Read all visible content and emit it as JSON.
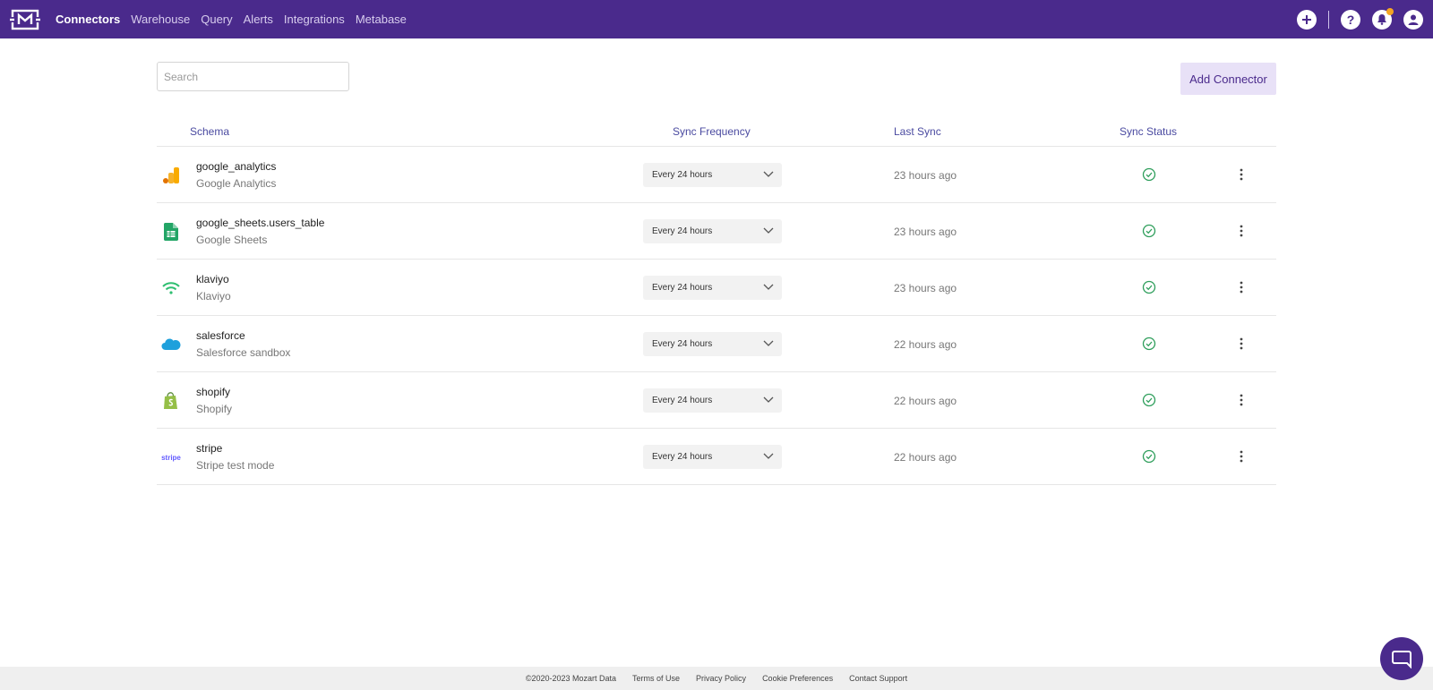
{
  "brand": {
    "logo_icon": "mozart-logo-icon",
    "color": "#4a2a8c"
  },
  "nav": {
    "items": [
      {
        "label": "Connectors",
        "active": true
      },
      {
        "label": "Warehouse",
        "active": false
      },
      {
        "label": "Query",
        "active": false
      },
      {
        "label": "Alerts",
        "active": false
      },
      {
        "label": "Integrations",
        "active": false
      },
      {
        "label": "Metabase",
        "active": false
      }
    ]
  },
  "top_actions": {
    "add_icon": "plus-icon",
    "help_label": "?",
    "notification_icon": "bell-icon",
    "account_icon": "user-icon"
  },
  "search": {
    "placeholder": "Search",
    "value": ""
  },
  "add_connector": {
    "label": "Add Connector"
  },
  "table": {
    "headers": {
      "schema": "Schema",
      "sync_frequency": "Sync Frequency",
      "last_sync": "Last Sync",
      "sync_status": "Sync Status"
    },
    "rows": [
      {
        "icon": "google-analytics-icon",
        "schema": "google_analytics",
        "name": "Google Analytics",
        "frequency": "Every 24 hours",
        "last_sync": "23 hours ago",
        "status": "success"
      },
      {
        "icon": "google-sheets-icon",
        "schema": "google_sheets.users_table",
        "name": "Google Sheets",
        "frequency": "Every 24 hours",
        "last_sync": "23 hours ago",
        "status": "success"
      },
      {
        "icon": "klaviyo-icon",
        "schema": "klaviyo",
        "name": "Klaviyo",
        "frequency": "Every 24 hours",
        "last_sync": "23 hours ago",
        "status": "success"
      },
      {
        "icon": "salesforce-icon",
        "schema": "salesforce",
        "name": "Salesforce sandbox",
        "frequency": "Every 24 hours",
        "last_sync": "22 hours ago",
        "status": "success"
      },
      {
        "icon": "shopify-icon",
        "schema": "shopify",
        "name": "Shopify",
        "frequency": "Every 24 hours",
        "last_sync": "22 hours ago",
        "status": "success"
      },
      {
        "icon": "stripe-icon",
        "icon_text": "stripe",
        "schema": "stripe",
        "name": "Stripe test mode",
        "frequency": "Every 24 hours",
        "last_sync": "22 hours ago",
        "status": "success"
      }
    ]
  },
  "footer": {
    "copyright": "©2020-2023 Mozart Data",
    "links": [
      "Terms of Use",
      "Privacy Policy",
      "Cookie Preferences",
      "Contact Support"
    ]
  },
  "chat": {
    "icon": "chat-bubble-icon"
  },
  "colors": {
    "header_bg": "#4a2a8c",
    "header_text": "#4a4aa0",
    "status_green": "#2e9e5b",
    "button_bg": "#e8e1f7"
  }
}
